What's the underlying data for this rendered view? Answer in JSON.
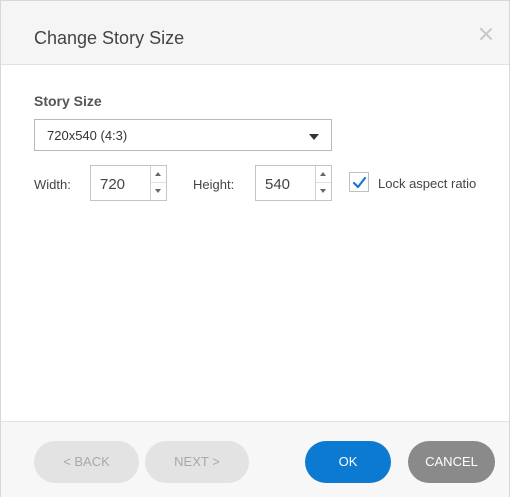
{
  "dialog": {
    "title": "Change Story Size",
    "close_icon": "close-icon"
  },
  "story_size": {
    "label": "Story Size",
    "selected": "720x540 (4:3)"
  },
  "dimensions": {
    "width_label": "Width:",
    "width_value": "720",
    "height_label": "Height:",
    "height_value": "540",
    "lock_label": "Lock aspect ratio",
    "lock_checked": true
  },
  "footer": {
    "back_label": "< BACK",
    "next_label": "NEXT >",
    "ok_label": "OK",
    "cancel_label": "CANCEL"
  },
  "colors": {
    "primary": "#0d7ad2",
    "check": "#1a73d9",
    "cancel": "#8a8a8a",
    "disabled": "#e3e3e3"
  }
}
